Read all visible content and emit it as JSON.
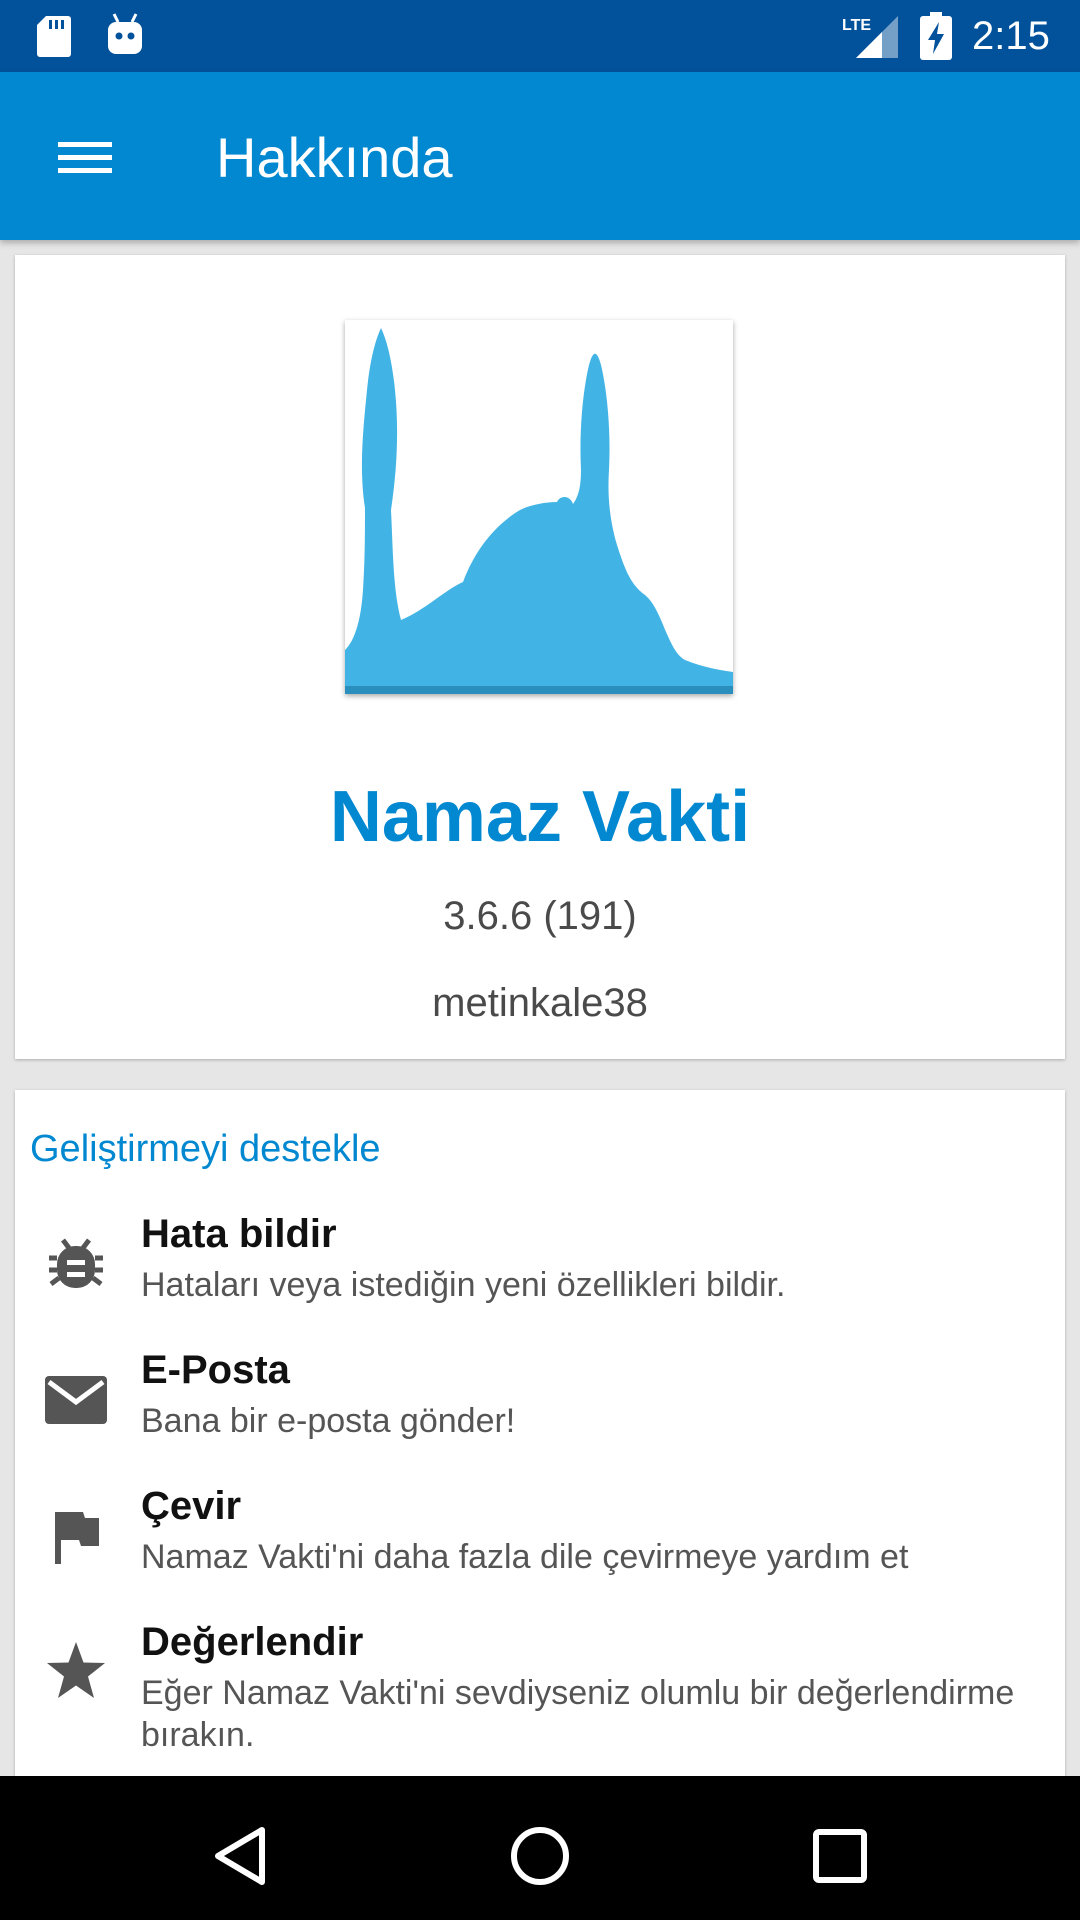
{
  "status_bar": {
    "time": "2:15",
    "network": "LTE",
    "icons": [
      "sd-card-icon",
      "android-debug-icon",
      "lte-signal-icon",
      "battery-charging-icon"
    ]
  },
  "app_bar": {
    "title": "Hakkında",
    "menu_icon": "menu-icon",
    "color": "#0288d1"
  },
  "about": {
    "logo": "mosque-logo",
    "app_name": "Namaz Vakti",
    "version": "3.6.6 (191)",
    "author": "metinkale38"
  },
  "support": {
    "title": "Geliştirmeyi destekle",
    "items": [
      {
        "icon": "bug-icon",
        "title": "Hata bildir",
        "subtitle": "Hataları veya istediğin yeni özellikleri bildir."
      },
      {
        "icon": "email-icon",
        "title": "E-Posta",
        "subtitle": "Bana bir e-posta gönder!"
      },
      {
        "icon": "flag-icon",
        "title": "Çevir",
        "subtitle": "Namaz Vakti'ni daha fazla dile çevirmeye yardım et"
      },
      {
        "icon": "star-icon",
        "title": "Değerlendir",
        "subtitle": "Eğer Namaz Vakti'ni sevdiyseniz olumlu bir değerlendirme bırakın."
      }
    ]
  },
  "nav_bar": {
    "buttons": [
      "back-icon",
      "home-icon",
      "recents-icon"
    ]
  }
}
